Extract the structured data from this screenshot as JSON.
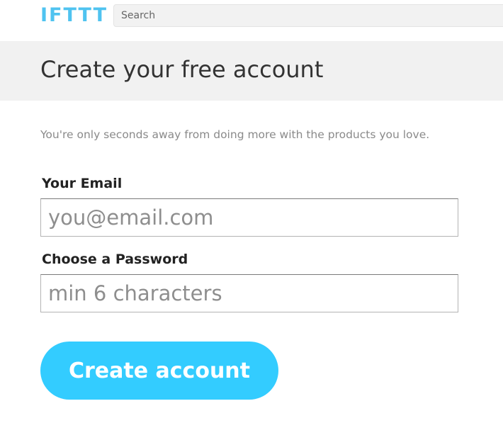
{
  "header": {
    "logo_text": "IFTTT",
    "search_placeholder": "Search",
    "brand_color": "#33ccff"
  },
  "page": {
    "title": "Create your free account",
    "tagline": "You're only seconds away from doing more with the products you love."
  },
  "form": {
    "email_label": "Your Email",
    "email_placeholder": "you@email.com",
    "password_label": "Choose a Password",
    "password_placeholder": "min 6 characters",
    "submit_label": "Create account"
  }
}
